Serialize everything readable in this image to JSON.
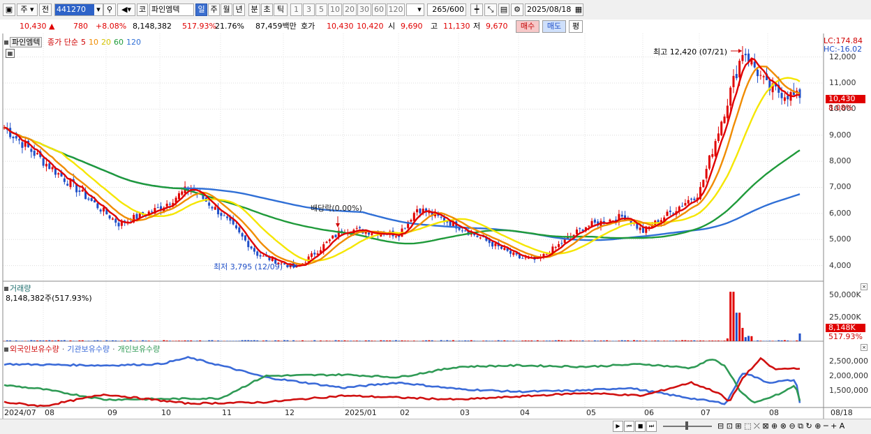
{
  "toolbar": {
    "period_type": "주",
    "prev_label": "전",
    "stock_code": "441270",
    "market_label": "코",
    "stock_name": "파인엠텍",
    "periods": [
      "일",
      "주",
      "월",
      "년",
      "분",
      "초",
      "틱"
    ],
    "active_period": "일",
    "intervals": [
      "1",
      "3",
      "5",
      "10",
      "20",
      "30",
      "60",
      "120"
    ],
    "count_display": "265",
    "count_max": "/600",
    "date": "2025/08/18"
  },
  "quote": {
    "price": "10,430",
    "change": "780",
    "change_pct": "+8.08%",
    "volume": "8,148,382",
    "volume_ratio": "517.93%",
    "turnover": "21.76%",
    "amount": "87,459백만",
    "bid_label": "호가",
    "ask": "10,430",
    "bid": "10,420",
    "open_label": "시",
    "open": "9,690",
    "high_label": "고",
    "high": "11,130",
    "low_label": "저",
    "low": "9,670",
    "buy_button": "매수",
    "sell_button": "매도",
    "avg_button": "평"
  },
  "price_panel": {
    "name_tag": "파인엠텍",
    "legend_prefix": "종가 단순",
    "ma_5": "5",
    "ma_10": "10",
    "ma_20": "20",
    "ma_60": "60",
    "ma_120": "120",
    "lc": "LC:174.84",
    "hc": "HC:-16.02",
    "annotation_high": "최고 12,420 (07/21)",
    "annotation_low": "최저 3,795 (12/09)",
    "annotation_dividend": "배당락(0.00%)",
    "current_badge": "10,430",
    "current_pct": "8.08%"
  },
  "volume_panel": {
    "title": "거래량",
    "value_text": "8,148,382주(517.93%)",
    "badge": "8,148K",
    "badge_pct": "517.93%"
  },
  "holdings_panel": {
    "foreign_label": "외국인보유수량",
    "institution_label": "기관보유수량",
    "individual_label": "개인보유수량"
  },
  "x_axis": [
    "2024/07",
    "08",
    "09",
    "10",
    "11",
    "12",
    "2025/01",
    "02",
    "03",
    "04",
    "05",
    "06",
    "07",
    "08",
    "08/18"
  ],
  "colors": {
    "ma5": "#e00000",
    "ma10": "#f08c00",
    "ma20": "#f5e600",
    "ma60": "#1f9a3a",
    "ma120": "#2f6fd6",
    "up": "#e00000",
    "down": "#1f4fc8",
    "foreign": "#d01010",
    "institution": "#3a6ad8",
    "individual": "#2f9a55"
  },
  "chart_data": [
    {
      "type": "candlestick",
      "title": "파인엠텍 종가 단순 5 10 20 60 120",
      "y_ticks": [
        "12,000",
        "11,000",
        "10,000",
        "9,000",
        "8,000",
        "7,000",
        "6,000",
        "5,000",
        "4,000"
      ],
      "ylim": [
        3400,
        12900
      ],
      "close_path_key_points": [
        {
          "x": "2024/07",
          "y": 9300
        },
        {
          "x": "08",
          "y": 8000
        },
        {
          "x": "09",
          "y": 5600
        },
        {
          "x": "10",
          "y": 6200
        },
        {
          "x": "10 mid",
          "y": 7000
        },
        {
          "x": "11",
          "y": 6000
        },
        {
          "x": "11 late",
          "y": 4400
        },
        {
          "x": "12/09",
          "y": 3900
        },
        {
          "x": "2025/01",
          "y": 5400
        },
        {
          "x": "02",
          "y": 5200
        },
        {
          "x": "02 mid",
          "y": 6200
        },
        {
          "x": "03",
          "y": 5500
        },
        {
          "x": "04",
          "y": 4300
        },
        {
          "x": "04 late",
          "y": 4200
        },
        {
          "x": "05",
          "y": 5500
        },
        {
          "x": "05 late",
          "y": 5900
        },
        {
          "x": "06",
          "y": 5300
        },
        {
          "x": "07",
          "y": 6800
        },
        {
          "x": "07/21",
          "y": 12300
        },
        {
          "x": "08",
          "y": 10800
        },
        {
          "x": "08/18",
          "y": 10430
        }
      ]
    },
    {
      "type": "bar",
      "title": "거래량",
      "y_ticks": [
        "50,000K",
        "25,000K"
      ],
      "notable": [
        {
          "x": "07/21",
          "value_k": 52000
        },
        {
          "x": "07 late",
          "value_k": 30000
        },
        {
          "x": "08/18",
          "value_k": 8148
        }
      ]
    },
    {
      "type": "line",
      "title": "보유수량",
      "y_ticks": [
        "2,500,000",
        "2,000,000",
        "1,500,000"
      ]
    }
  ],
  "bottombar": {
    "icons": [
      "scroll-left",
      "first",
      "stop",
      "last"
    ]
  }
}
